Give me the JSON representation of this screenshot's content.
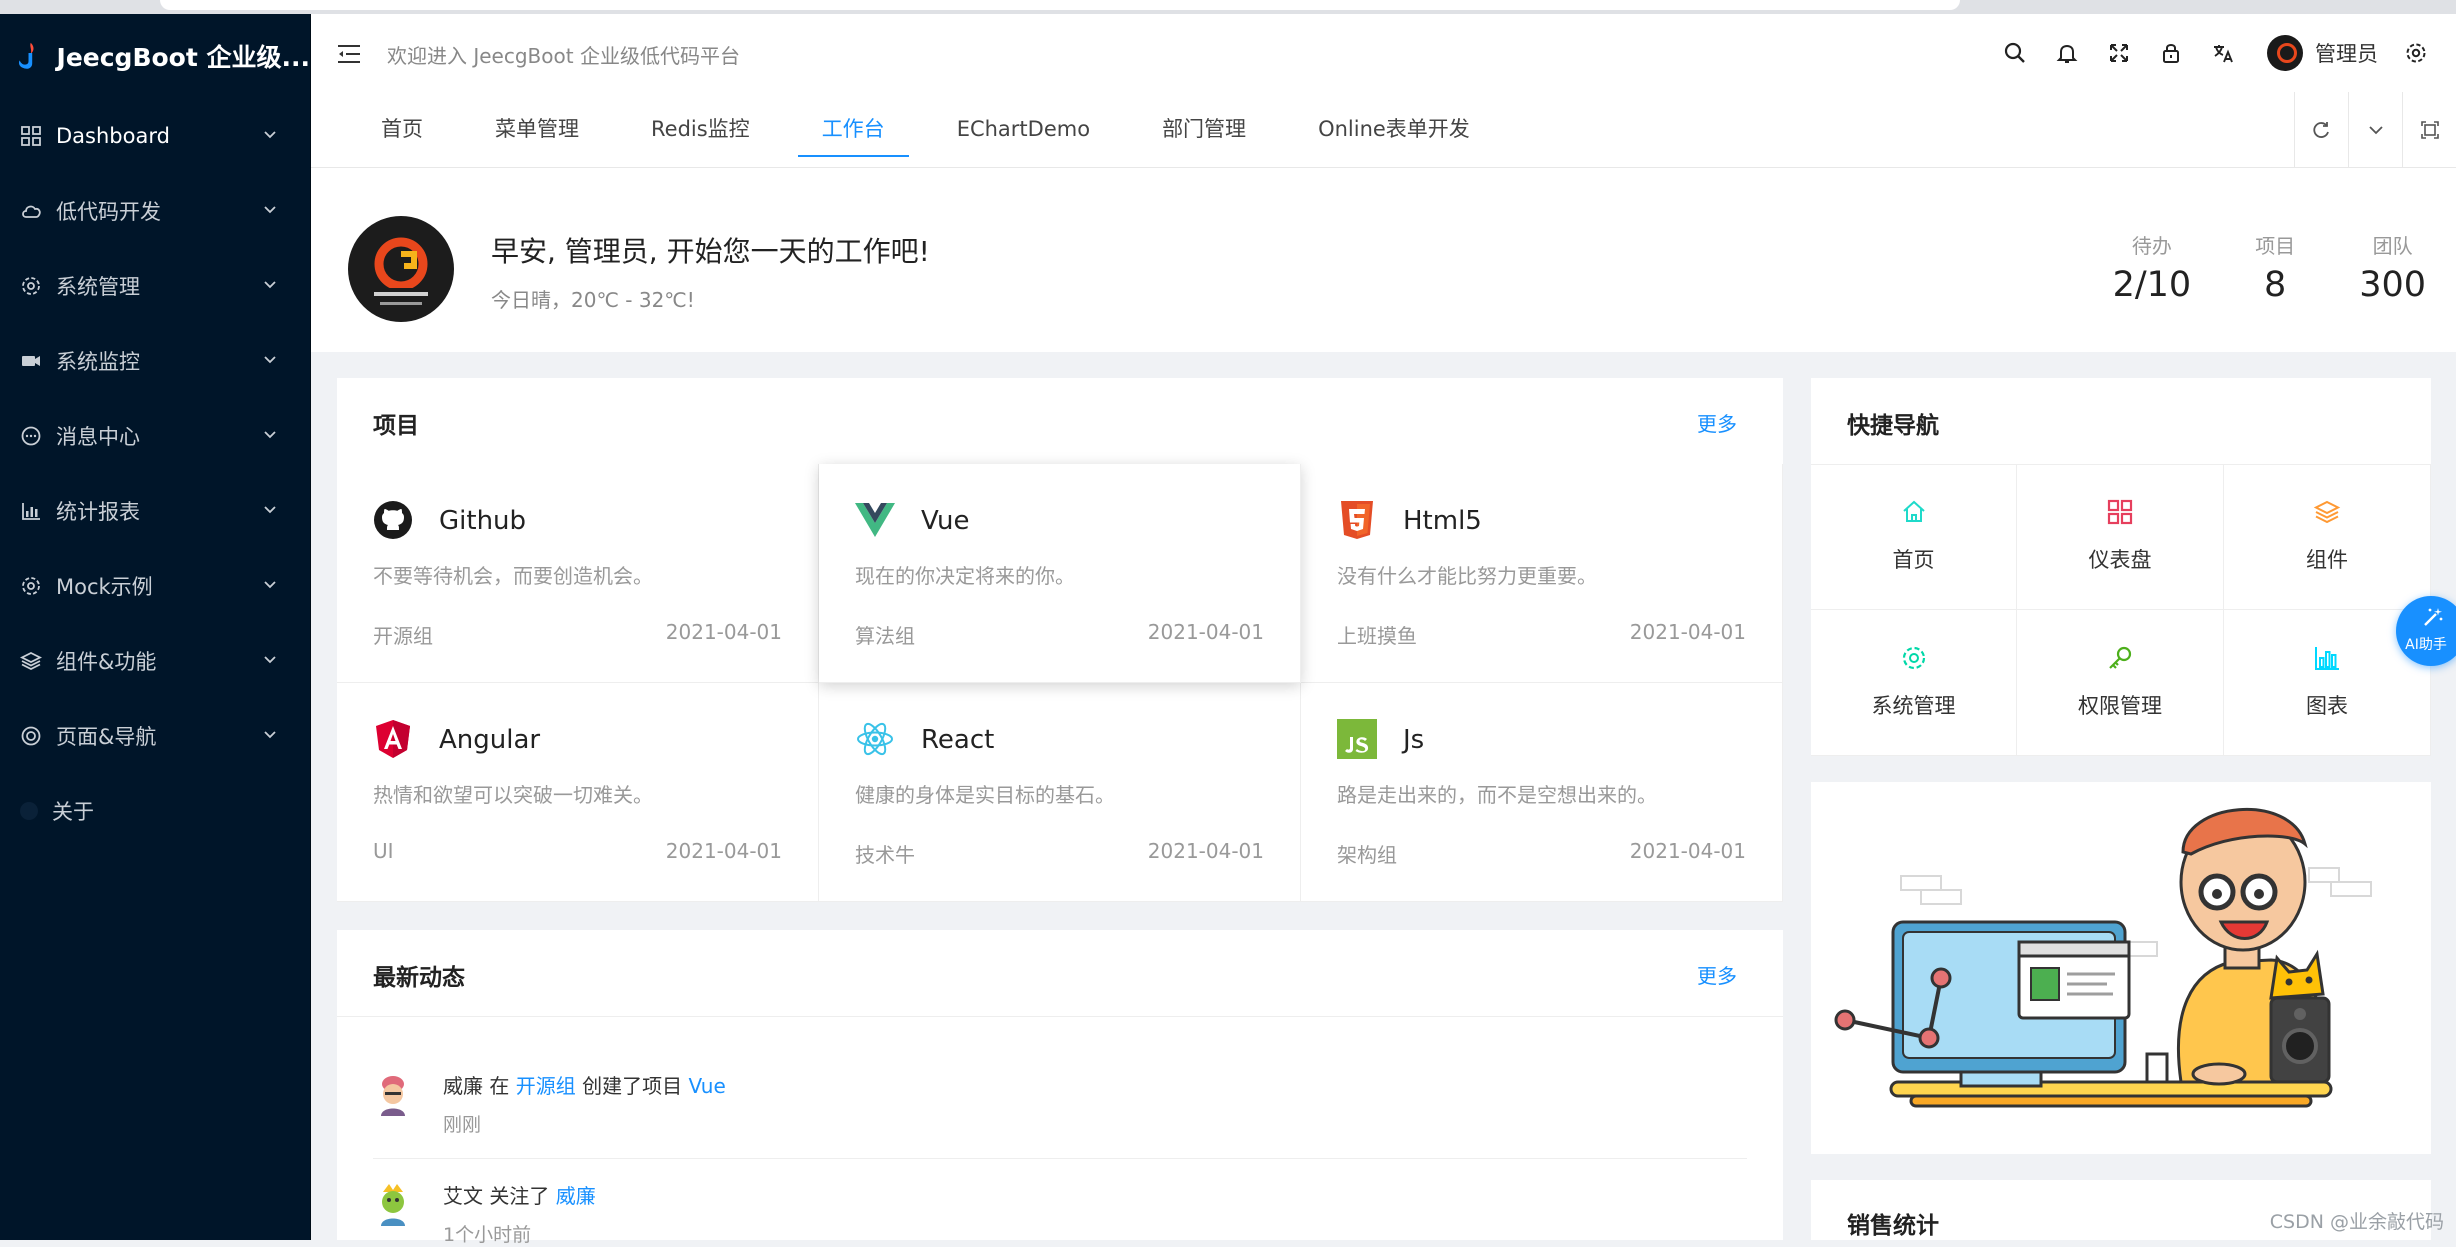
{
  "app": {
    "title": "JeecgBoot 企业级..."
  },
  "sidebar": {
    "items": [
      {
        "label": "Dashboard",
        "icon": "dashboard-icon"
      },
      {
        "label": "低代码开发",
        "icon": "cloud-icon"
      },
      {
        "label": "系统管理",
        "icon": "gear-icon"
      },
      {
        "label": "系统监控",
        "icon": "video-icon"
      },
      {
        "label": "消息中心",
        "icon": "message-icon"
      },
      {
        "label": "统计报表",
        "icon": "bar-chart-icon"
      },
      {
        "label": "Mock示例",
        "icon": "gear-icon"
      },
      {
        "label": "组件&功能",
        "icon": "layers-icon"
      },
      {
        "label": "页面&导航",
        "icon": "target-icon"
      },
      {
        "label": "关于",
        "icon": "dot-icon"
      }
    ]
  },
  "header": {
    "welcome": "欢迎进入 JeecgBoot 企业级低代码平台",
    "username": "管理员"
  },
  "tabs": [
    "首页",
    "菜单管理",
    "Redis监控",
    "工作台",
    "EChartDemo",
    "部门管理",
    "Online表单开发"
  ],
  "greeting": {
    "hello": "早安, 管理员, 开始您一天的工作吧!",
    "weather": "今日晴，20℃ - 32℃!",
    "stats": [
      {
        "label": "待办",
        "value": "2/10"
      },
      {
        "label": "项目",
        "value": "8"
      },
      {
        "label": "团队",
        "value": "300"
      }
    ]
  },
  "projects": {
    "title": "项目",
    "more": "更多",
    "items": [
      {
        "name": "Github",
        "desc": "不要等待机会，而要创造机会。",
        "group": "开源组",
        "date": "2021-04-01",
        "icon": "github-icon"
      },
      {
        "name": "Vue",
        "desc": "现在的你决定将来的你。",
        "group": "算法组",
        "date": "2021-04-01",
        "icon": "vue-icon"
      },
      {
        "name": "Html5",
        "desc": "没有什么才能比努力更重要。",
        "group": "上班摸鱼",
        "date": "2021-04-01",
        "icon": "html5-icon"
      },
      {
        "name": "Angular",
        "desc": "热情和欲望可以突破一切难关。",
        "group": "UI",
        "date": "2021-04-01",
        "icon": "angular-icon"
      },
      {
        "name": "React",
        "desc": "健康的身体是实目标的基石。",
        "group": "技术牛",
        "date": "2021-04-01",
        "icon": "react-icon"
      },
      {
        "name": "Js",
        "desc": "路是走出来的，而不是空想出来的。",
        "group": "架构组",
        "date": "2021-04-01",
        "icon": "js-icon"
      }
    ]
  },
  "activity": {
    "title": "最新动态",
    "more": "更多",
    "items": [
      {
        "user": "威廉",
        "pre": " 在 ",
        "target": "开源组",
        "mid": " 创建了项目 ",
        "object": "Vue",
        "time": "刚刚"
      },
      {
        "user": "艾文",
        "pre": " 关注了 ",
        "target": "威廉",
        "mid": "",
        "object": "",
        "time": "1个小时前"
      }
    ]
  },
  "shortcuts": {
    "title": "快捷导航",
    "items": [
      {
        "label": "首页",
        "icon": "home-icon",
        "color": "#1fdaca"
      },
      {
        "label": "仪表盘",
        "icon": "dashboard-grid-icon",
        "color": "#e63f5d"
      },
      {
        "label": "组件",
        "icon": "layers-icon",
        "color": "#ff9933"
      },
      {
        "label": "系统管理",
        "icon": "gear-icon",
        "color": "#00d8a8"
      },
      {
        "label": "权限管理",
        "icon": "key-icon",
        "color": "#4daf1b"
      },
      {
        "label": "图表",
        "icon": "bar-chart-icon",
        "color": "#00d8ff"
      }
    ]
  },
  "sales": {
    "title": "销售统计"
  },
  "ai": {
    "label": "AI助手"
  },
  "watermark": "CSDN @业余敲代码",
  "colors": {
    "sidebar_bg": "#001529",
    "accent": "#1890ff"
  }
}
